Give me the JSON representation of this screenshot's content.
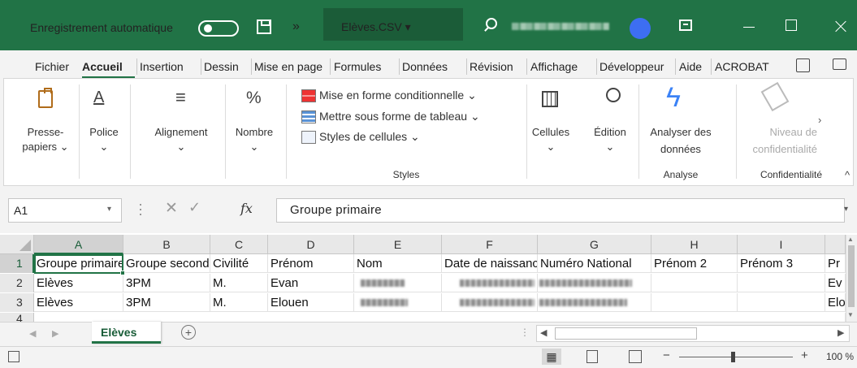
{
  "titlebar": {
    "autosave_label": "Enregistrement automatique",
    "autosave_state": "off",
    "more_label": "»",
    "filename": "Elèves.CSV ▾",
    "accent_color": "#217346"
  },
  "tabs": [
    "Fichier",
    "Accueil",
    "Insertion",
    "Dessin",
    "Mise en page",
    "Formules",
    "Données",
    "Révision",
    "Affichage",
    "Développeur",
    "Aide",
    "ACROBAT"
  ],
  "active_tab": "Accueil",
  "ribbon": {
    "paste": "Presse-",
    "paste2": "papiers ⌄",
    "font": "Police",
    "align": "Alignement",
    "number": "Nombre",
    "cond_format": "Mise en forme conditionnelle ⌄",
    "table_format": "Mettre sous forme de tableau ⌄",
    "cell_styles": "Styles de cellules ⌄",
    "styles_group": "Styles",
    "cells": "Cellules",
    "edit": "Édition",
    "analyze1": "Analyser des",
    "analyze2": "données",
    "analyze_group": "Analyse",
    "sensitivity1": "Niveau de",
    "sensitivity2": "confidentialité",
    "sensitivity_group": "Confidentialité",
    "dropdown": "⌄"
  },
  "formula_bar": {
    "cell_ref": "A1",
    "fx": "fx",
    "cancel": "✕",
    "enter": "✓",
    "formula": "Groupe primaire"
  },
  "columns": [
    "A",
    "B",
    "C",
    "D",
    "E",
    "F",
    "G",
    "H",
    "I"
  ],
  "row_numbers": [
    "1",
    "2",
    "3",
    "4"
  ],
  "header_cells": [
    "Groupe primaire",
    "Groupe secondaire",
    "Civilité",
    "Prénom",
    "Nom",
    "Date de naissance",
    "Numéro National",
    "Prénom 2",
    "Prénom 3",
    "Pr"
  ],
  "rows": [
    {
      "a": "Elèves",
      "b": "3PM",
      "c": "M.",
      "d": "Evan",
      "j": "Ev"
    },
    {
      "a": "Elèves",
      "b": "3PM",
      "c": "M.",
      "d": "Elouen",
      "j": "Elo"
    }
  ],
  "sheet": {
    "tab": "Elèves",
    "add": "+"
  },
  "status": {
    "zoom": "100 %",
    "minus": "−",
    "plus": "+"
  }
}
